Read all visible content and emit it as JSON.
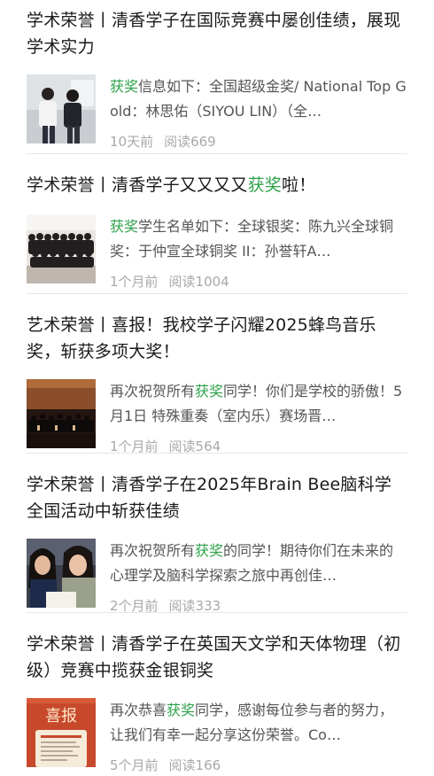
{
  "colors": {
    "highlight": "#2ea24a",
    "title": "#1a1a1a",
    "summary": "#555555",
    "meta": "#a8a8a8",
    "divider": "#e6e6e6"
  },
  "articles": [
    {
      "title": "学术荣誉丨清香学子在国际竞赛中屡创佳绩，展现学术实力",
      "summary_hl": "获奖",
      "summary_rest": "信息如下：全国超级金奖/ National Top Gold：林思佑（SIYOU LIN）（全…",
      "time": "10天前",
      "reads": "阅读669",
      "thumb_icon": "students-presenting-photo"
    },
    {
      "title_before": "学术荣誉丨清香学子又又又又",
      "title_hl": "获奖",
      "title_after": "啦！",
      "summary_hl": "获奖",
      "summary_rest": "学生名单如下：全球银奖：陈九兴全球铜奖：于仲宣全球铜奖 II：孙誉轩A…",
      "time": "1个月前",
      "reads": "阅读1004",
      "thumb_icon": "group-photo"
    },
    {
      "title": "艺术荣誉丨喜报！我校学子闪耀2025蜂鸟音乐奖，斩获多项大奖！",
      "summary_before": "再次祝贺所有",
      "summary_hl": "获奖",
      "summary_after": "同学！你们是学校的骄傲！5月1日 特殊重奏（室内乐）赛场晋…",
      "time": "1个月前",
      "reads": "阅读564",
      "thumb_icon": "orchestra-photo"
    },
    {
      "title": "学术荣誉丨清香学子在2025年Brain Bee脑科学全国活动中斩获佳绩",
      "summary_before": "再次祝贺所有",
      "summary_hl": "获奖",
      "summary_after": "的同学！期待你们在未来的心理学及脑科学探索之旅中再创佳…",
      "time": "2个月前",
      "reads": "阅读333",
      "thumb_icon": "students-writing-photo"
    },
    {
      "title": "学术荣誉丨清香学子在英国天文学和天体物理（初级）竞赛中揽获金银铜奖",
      "summary_before": "再次恭喜",
      "summary_hl": "获奖",
      "summary_after": "同学，感谢每位参与者的努力，让我们有幸一起分享这份荣誉。Co…",
      "time": "5个月前",
      "reads": "阅读166",
      "thumb_icon": "good-news-poster",
      "thumb_text": "喜报"
    }
  ]
}
